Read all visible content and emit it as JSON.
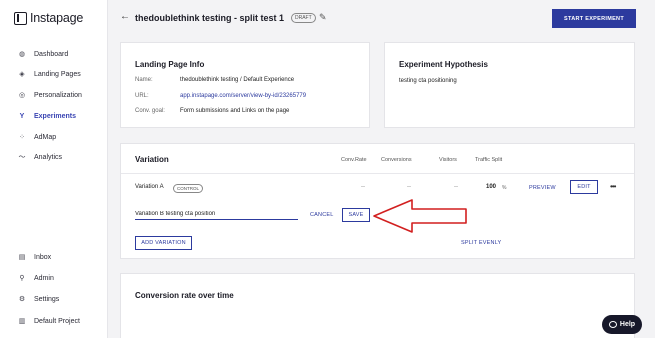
{
  "brand": {
    "logo_text": "Instapage"
  },
  "sidebar": {
    "top_items": [
      {
        "label": "Dashboard",
        "icon": "dashboard-icon",
        "glyph": "◍"
      },
      {
        "label": "Landing Pages",
        "icon": "layers-icon",
        "glyph": "◈"
      },
      {
        "label": "Personalization",
        "icon": "target-icon",
        "glyph": "◎"
      },
      {
        "label": "Experiments",
        "icon": "experiments-icon",
        "glyph": "Y",
        "active": true
      },
      {
        "label": "AdMap",
        "icon": "admap-icon",
        "glyph": "⁘"
      },
      {
        "label": "Analytics",
        "icon": "analytics-icon",
        "glyph": "〜"
      }
    ],
    "bottom_items": [
      {
        "label": "Inbox",
        "icon": "inbox-icon",
        "glyph": "▤"
      },
      {
        "label": "Admin",
        "icon": "admin-icon",
        "glyph": "⚲"
      },
      {
        "label": "Settings",
        "icon": "gear-icon",
        "glyph": "⚙"
      },
      {
        "label": "Default Project",
        "icon": "project-icon",
        "glyph": "▥"
      }
    ]
  },
  "header": {
    "back_glyph": "←",
    "title": "thedoublethink testing - split test 1",
    "draft_badge": "DRAFT",
    "edit_glyph": "✎",
    "start_button": "START EXPERIMENT"
  },
  "landing_info": {
    "title": "Landing Page Info",
    "name_label": "Name:",
    "name_value": "thedoublethink testing / Default Experience",
    "url_label": "URL:",
    "url_value": "app.instapage.com/server/view-by-id/23265779",
    "goal_label": "Conv. goal:",
    "goal_value": "Form submissions and Links on the page"
  },
  "hypothesis": {
    "title": "Experiment Hypothesis",
    "text": "testing cta positioning"
  },
  "variation": {
    "title": "Variation",
    "columns": {
      "conv_rate": "Conv.Rate",
      "conversions": "Conversions",
      "visitors": "Visitors",
      "traffic_split": "Traffic Split"
    },
    "row_a": {
      "name": "Variation A",
      "badge": "CONTROL",
      "conv_rate": "--",
      "conversions": "--",
      "visitors": "--",
      "split": "100",
      "split_unit": "%",
      "preview": "PREVIEW",
      "edit": "EDIT",
      "menu": "•••"
    },
    "row_b": {
      "input_value": "Variation B testing cta position",
      "cancel": "CANCEL",
      "save": "SAVE"
    },
    "add_variation": "ADD VARIATION",
    "split_evenly": "SPLIT EVENLY"
  },
  "conversion_chart": {
    "title": "Conversion rate over time"
  },
  "help": {
    "label": "Help"
  },
  "colors": {
    "brand": "#2c3a9e",
    "annotation": "#d21f1f"
  }
}
